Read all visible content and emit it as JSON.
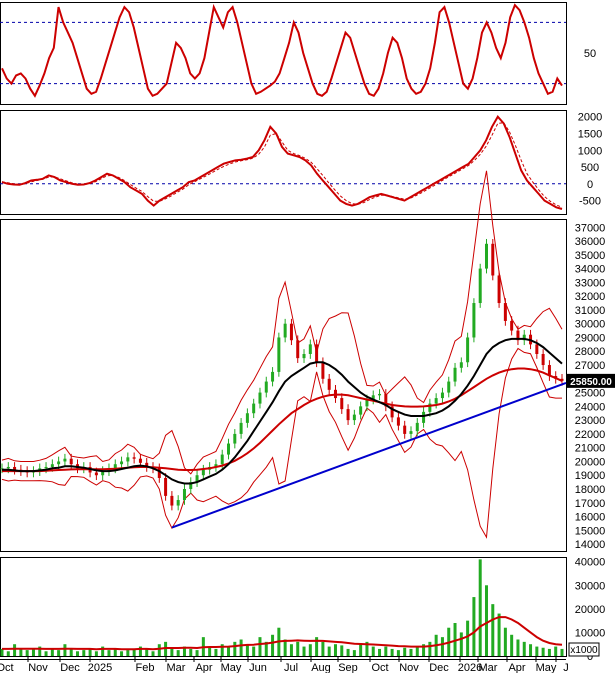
{
  "colors": {
    "price": "#cc0000",
    "ma_fast": "#000000",
    "bands": "#cc0000",
    "trendline": "#0000cc",
    "volume": "#22aa22",
    "volume_ma": "#cc0000",
    "grid_dash": "#0000aa",
    "last_price_bg": "#000000",
    "last_price_fg": "#ffffff"
  },
  "months": [
    "Oct",
    "Nov",
    "Dec",
    "2025",
    "Feb",
    "Mar",
    "Apr",
    "May",
    "Jun",
    "Jul",
    "Aug",
    "Sep",
    "Oct",
    "Nov",
    "Dec",
    "2026",
    "Mar",
    "Apr",
    "May",
    "J"
  ],
  "volume_unit_label": "x1000",
  "chart_data": [
    {
      "type": "line",
      "panel": "oscillator",
      "y_ticks": [
        "50"
      ],
      "reference_levels": [
        80,
        20
      ],
      "series": [
        {
          "values": [
            35,
            25,
            20,
            28,
            30,
            25,
            15,
            8,
            18,
            30,
            45,
            55,
            95,
            80,
            70,
            60,
            45,
            30,
            15,
            10,
            12,
            25,
            40,
            55,
            70,
            85,
            95,
            90,
            75,
            55,
            35,
            15,
            8,
            10,
            15,
            20,
            40,
            60,
            55,
            45,
            30,
            25,
            30,
            45,
            70,
            95,
            85,
            75,
            90,
            95,
            80,
            60,
            40,
            20,
            10,
            12,
            15,
            18,
            22,
            30,
            45,
            60,
            80,
            70,
            50,
            35,
            20,
            10,
            8,
            12,
            25,
            40,
            55,
            70,
            65,
            50,
            35,
            20,
            10,
            8,
            15,
            30,
            50,
            65,
            60,
            45,
            25,
            15,
            10,
            12,
            20,
            35,
            60,
            90,
            95,
            80,
            60,
            40,
            20,
            15,
            25,
            45,
            70,
            80,
            70,
            55,
            45,
            60,
            85,
            97,
            92,
            80,
            65,
            45,
            30,
            20,
            10,
            12,
            25,
            18
          ]
        }
      ]
    },
    {
      "type": "line",
      "panel": "macd",
      "y_ticks": [
        "2000",
        "1500",
        "1000",
        "500",
        "0",
        "-500"
      ],
      "ylim": [
        -900,
        2200
      ],
      "series": [
        {
          "values": [
            50,
            0,
            -20,
            -30,
            20,
            100,
            120,
            150,
            250,
            200,
            100,
            50,
            0,
            -30,
            -20,
            20,
            100,
            200,
            300,
            250,
            150,
            50,
            -100,
            -200,
            -300,
            -500,
            -650,
            -500,
            -400,
            -300,
            -200,
            -100,
            50,
            100,
            200,
            300,
            400,
            500,
            600,
            650,
            700,
            720,
            750,
            800,
            1000,
            1300,
            1700,
            1500,
            1100,
            900,
            850,
            800,
            700,
            550,
            300,
            100,
            -100,
            -300,
            -500,
            -600,
            -650,
            -600,
            -500,
            -400,
            -350,
            -300,
            -350,
            -400,
            -450,
            -500,
            -400,
            -300,
            -200,
            -100,
            0,
            100,
            200,
            300,
            400,
            500,
            600,
            800,
            1000,
            1300,
            1700,
            2000,
            1800,
            1400,
            900,
            400,
            100,
            -100,
            -300,
            -500,
            -600,
            -700,
            -750
          ]
        },
        {
          "values": [
            60,
            30,
            0,
            -20,
            0,
            60,
            100,
            140,
            200,
            210,
            150,
            90,
            30,
            -10,
            -20,
            0,
            60,
            150,
            240,
            250,
            190,
            100,
            -20,
            -130,
            -230,
            -380,
            -520,
            -520,
            -450,
            -360,
            -260,
            -160,
            -30,
            60,
            150,
            240,
            330,
            430,
            520,
            590,
            650,
            690,
            720,
            760,
            880,
            1100,
            1450,
            1500,
            1250,
            1000,
            900,
            840,
            760,
            640,
            450,
            250,
            30,
            -170,
            -360,
            -500,
            -590,
            -610,
            -560,
            -470,
            -400,
            -340,
            -340,
            -380,
            -420,
            -460,
            -430,
            -350,
            -260,
            -160,
            -60,
            50,
            150,
            250,
            350,
            450,
            550,
            700,
            880,
            1120,
            1450,
            1800,
            1820,
            1550,
            1150,
            700,
            300,
            50,
            -180,
            -380,
            -520,
            -630,
            -700
          ]
        }
      ]
    },
    {
      "type": "line",
      "panel": "price",
      "y_ticks": [
        "37000",
        "36000",
        "35000",
        "34000",
        "33000",
        "32000",
        "31000",
        "30000",
        "29000",
        "28000",
        "27000",
        "26000",
        "25000",
        "24000",
        "23000",
        "22000",
        "21000",
        "20000",
        "19000",
        "18000",
        "17000",
        "16000",
        "15000",
        "14000"
      ],
      "ylim": [
        13500,
        37600
      ],
      "last_price_label": "25850.00",
      "series": [
        {
          "name_hidden": "close",
          "values": [
            19500,
            19600,
            19400,
            19300,
            19200,
            19300,
            19500,
            19600,
            19800,
            20000,
            20200,
            19800,
            19500,
            19600,
            19200,
            19000,
            19300,
            19500,
            19800,
            20000,
            20300,
            20200,
            19900,
            19600,
            19500,
            18800,
            17500,
            16800,
            17200,
            18000,
            18500,
            19000,
            19400,
            19600,
            19800,
            20500,
            21300,
            22000,
            22800,
            23500,
            24200,
            25000,
            25800,
            26500,
            29000,
            30000,
            28800,
            27500,
            27800,
            28500,
            27200,
            26000,
            25200,
            24600,
            23800,
            23000,
            23400,
            24000,
            24500,
            24800,
            24900,
            24000,
            23200,
            22600,
            22000,
            22200,
            22800,
            23600,
            24200,
            24600,
            25000,
            25800,
            26800,
            27200,
            29000,
            31500,
            34000,
            35800,
            33500,
            31500,
            30200,
            29500,
            28800,
            29200,
            28500,
            27800,
            27000,
            26200,
            26000,
            25850
          ]
        },
        {
          "name_hidden": "ma_fast",
          "values": [
            19400,
            19400,
            19350,
            19300,
            19300,
            19300,
            19350,
            19400,
            19500,
            19550,
            19650,
            19650,
            19600,
            19550,
            19450,
            19350,
            19300,
            19300,
            19350,
            19450,
            19550,
            19650,
            19700,
            19650,
            19500,
            19300,
            19000,
            18700,
            18500,
            18400,
            18400,
            18500,
            18700,
            18900,
            19100,
            19400,
            19800,
            20300,
            20900,
            21500,
            22200,
            22900,
            23600,
            24300,
            25100,
            25800,
            26200,
            26500,
            26800,
            27100,
            27200,
            27200,
            27000,
            26700,
            26300,
            25800,
            25400,
            25000,
            24700,
            24500,
            24300,
            24100,
            23800,
            23600,
            23400,
            23300,
            23300,
            23300,
            23400,
            23500,
            23700,
            24000,
            24400,
            24900,
            25500,
            26200,
            27000,
            27800,
            28300,
            28600,
            28800,
            28900,
            28900,
            28900,
            28800,
            28600,
            28300,
            27900,
            27500,
            27100
          ]
        },
        {
          "name_hidden": "ma_slow",
          "values": [
            19300,
            19300,
            19300,
            19300,
            19300,
            19300,
            19300,
            19320,
            19350,
            19380,
            19400,
            19420,
            19430,
            19440,
            19440,
            19440,
            19440,
            19450,
            19470,
            19500,
            19550,
            19580,
            19600,
            19600,
            19580,
            19550,
            19500,
            19450,
            19400,
            19380,
            19380,
            19400,
            19450,
            19500,
            19600,
            19700,
            19850,
            20050,
            20300,
            20600,
            20950,
            21350,
            21800,
            22250,
            22700,
            23100,
            23500,
            23800,
            24100,
            24350,
            24550,
            24700,
            24800,
            24850,
            24850,
            24800,
            24700,
            24600,
            24500,
            24400,
            24300,
            24200,
            24100,
            24050,
            24000,
            23980,
            23980,
            24000,
            24050,
            24100,
            24200,
            24350,
            24550,
            24800,
            25100,
            25400,
            25700,
            26000,
            26250,
            26450,
            26600,
            26700,
            26750,
            26750,
            26700,
            26600,
            26450,
            26250,
            26050,
            25850
          ]
        },
        {
          "name_hidden": "trendline",
          "values": [
            15200,
            25700
          ]
        }
      ]
    },
    {
      "type": "bar",
      "panel": "volume",
      "y_ticks": [
        "40000",
        "30000",
        "20000",
        "10000",
        "0"
      ],
      "ylim": [
        0,
        42000
      ],
      "series": [
        {
          "name_hidden": "volume",
          "values": [
            3000,
            2000,
            5000,
            3000,
            2500,
            3000,
            4000,
            2000,
            3000,
            2500,
            5000,
            3000,
            2000,
            2500,
            3000,
            2000,
            4000,
            2500,
            3000,
            2000,
            2500,
            3000,
            4000,
            3000,
            2000,
            5000,
            6000,
            3000,
            2500,
            4000,
            3000,
            2500,
            8000,
            4000,
            3000,
            5000,
            4000,
            6000,
            7000,
            5000,
            4000,
            8000,
            6000,
            9000,
            12000,
            7000,
            5000,
            6000,
            4000,
            5000,
            8000,
            6000,
            4000,
            5000,
            4500,
            3000,
            2500,
            5000,
            6000,
            4000,
            3000,
            4000,
            3000,
            2500,
            3500,
            3000,
            4000,
            5000,
            6000,
            9000,
            8000,
            12000,
            14000,
            10000,
            15000,
            25000,
            41000,
            30000,
            22000,
            18000,
            12000,
            9000,
            7000,
            6000,
            5000,
            4000,
            3500,
            3000,
            4000,
            3000
          ]
        },
        {
          "name_hidden": "volume_ma",
          "values": [
            3000,
            3000,
            3100,
            3100,
            3100,
            3100,
            3100,
            3000,
            3000,
            3000,
            3100,
            3100,
            3000,
            3000,
            3000,
            2900,
            3000,
            3000,
            3000,
            2900,
            2900,
            2900,
            3000,
            3000,
            2900,
            3100,
            3400,
            3400,
            3400,
            3500,
            3500,
            3400,
            3700,
            3800,
            3800,
            3900,
            4000,
            4200,
            4500,
            4700,
            4800,
            5100,
            5300,
            5700,
            6200,
            6400,
            6500,
            6600,
            6500,
            6400,
            6500,
            6400,
            6200,
            6000,
            5800,
            5500,
            5200,
            5100,
            5000,
            4900,
            4700,
            4600,
            4400,
            4200,
            4100,
            4000,
            4000,
            4000,
            4200,
            4600,
            5000,
            5700,
            6500,
            7300,
            8300,
            10000,
            12500,
            14000,
            15500,
            16500,
            16500,
            15500,
            14000,
            12000,
            10000,
            8000,
            6500,
            5500,
            5000,
            4800
          ]
        }
      ]
    }
  ]
}
